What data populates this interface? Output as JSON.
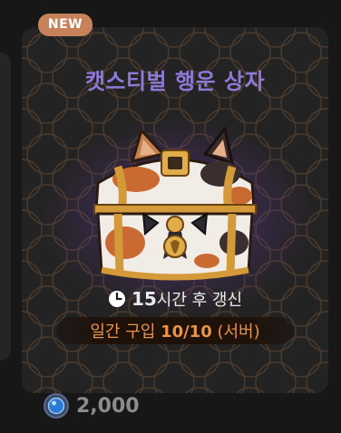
{
  "badge": {
    "label": "NEW",
    "color": "#c8825a"
  },
  "item": {
    "title": "캣스티벌 행운 상자",
    "title_color": "#8e78d8",
    "image_icon": "cat-chest-icon"
  },
  "refresh": {
    "icon": "clock-icon",
    "hours": "15",
    "suffix": "시간 후 갱신"
  },
  "purchase_limit": {
    "prefix": "일간 구입 ",
    "count": "10/10",
    "suffix": " (서버)",
    "color": "#e8924a"
  },
  "price": {
    "currency_icon": "blue-coin-icon",
    "amount": "2,000"
  }
}
